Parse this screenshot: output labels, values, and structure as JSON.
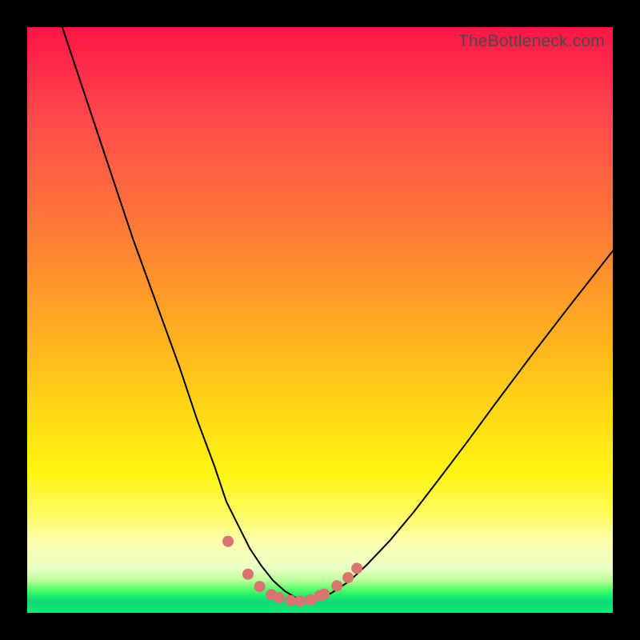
{
  "watermark": "TheBottleneck.com",
  "colors": {
    "frame": "#000000",
    "curve": "#000000",
    "marker": "#d8736f",
    "gradient_top": "#ff1546",
    "gradient_bottom_green": "#10ec70"
  },
  "chart_data": {
    "type": "line",
    "title": "",
    "xlabel": "",
    "ylabel": "",
    "xlim": [
      0,
      100
    ],
    "ylim": [
      0,
      100
    ],
    "note": "No axis tick labels are visible in the image; x and y values below are normalized 0–100 estimates based on pixel position within the plot area.",
    "series": [
      {
        "name": "curve",
        "x": [
          6,
          10,
          14,
          18,
          22,
          26,
          29,
          32,
          34,
          36,
          38,
          40,
          42,
          44,
          46,
          48,
          50,
          52,
          55,
          58,
          62,
          66,
          70,
          75,
          80,
          86,
          92,
          100
        ],
        "y": [
          100,
          88,
          76,
          64,
          53,
          42,
          33,
          25,
          19,
          15,
          11,
          8,
          5.5,
          3.7,
          2.5,
          2.0,
          2.4,
          3.4,
          5.4,
          8.2,
          12.4,
          17.2,
          22.4,
          29.0,
          35.8,
          43.8,
          51.6,
          61.8
        ]
      }
    ],
    "markers": {
      "name": "highlighted-points",
      "x": [
        34.3,
        37.7,
        39.7,
        41.7,
        43.0,
        45.0,
        46.6,
        48.4,
        49.9,
        50.7,
        52.9,
        54.8,
        56.3
      ],
      "y": [
        12.2,
        6.6,
        4.5,
        3.1,
        2.6,
        2.1,
        2.0,
        2.2,
        2.9,
        3.2,
        4.6,
        6.0,
        7.6
      ],
      "r": 7
    }
  }
}
